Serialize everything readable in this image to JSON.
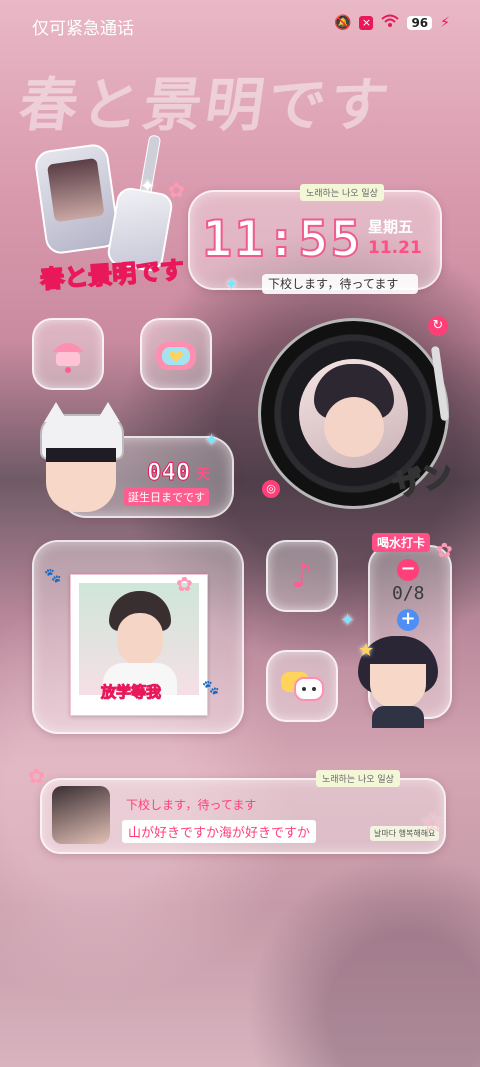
{
  "status_bar": {
    "carrier": "仅可紧急通话",
    "battery": "96",
    "icons": [
      "mute-icon",
      "x-badge-icon",
      "wifi-icon",
      "battery-icon",
      "charging-icon"
    ]
  },
  "background": {
    "title": "春と景明です"
  },
  "clock_widget": {
    "time": "11:55",
    "weekday": "星期五",
    "date": "11.21",
    "tag": "노래하는 나오 일상",
    "subtitle": "下校します，待ってます"
  },
  "sticker": {
    "logo_text": "春と景明です"
  },
  "countdown_widget": {
    "days": "040",
    "unit": "天",
    "caption": "誕生日までです"
  },
  "photo_widget": {
    "caption": "放学等我"
  },
  "water_widget": {
    "title": "喝水打卡",
    "minus": "−",
    "count": "0/8",
    "plus": "+"
  },
  "message_widget": {
    "line1": "下校します，待ってます",
    "line2": "山が好きですか海が好きですか",
    "tag": "노래하는 나오 일상",
    "stamp": "날마다 행복해해요"
  },
  "overlay_text": {
    "zan": "ザン"
  },
  "colors": {
    "accent": "#ff4f86",
    "accent_dark": "#e8185a",
    "water_plus": "#4f8ef5"
  }
}
